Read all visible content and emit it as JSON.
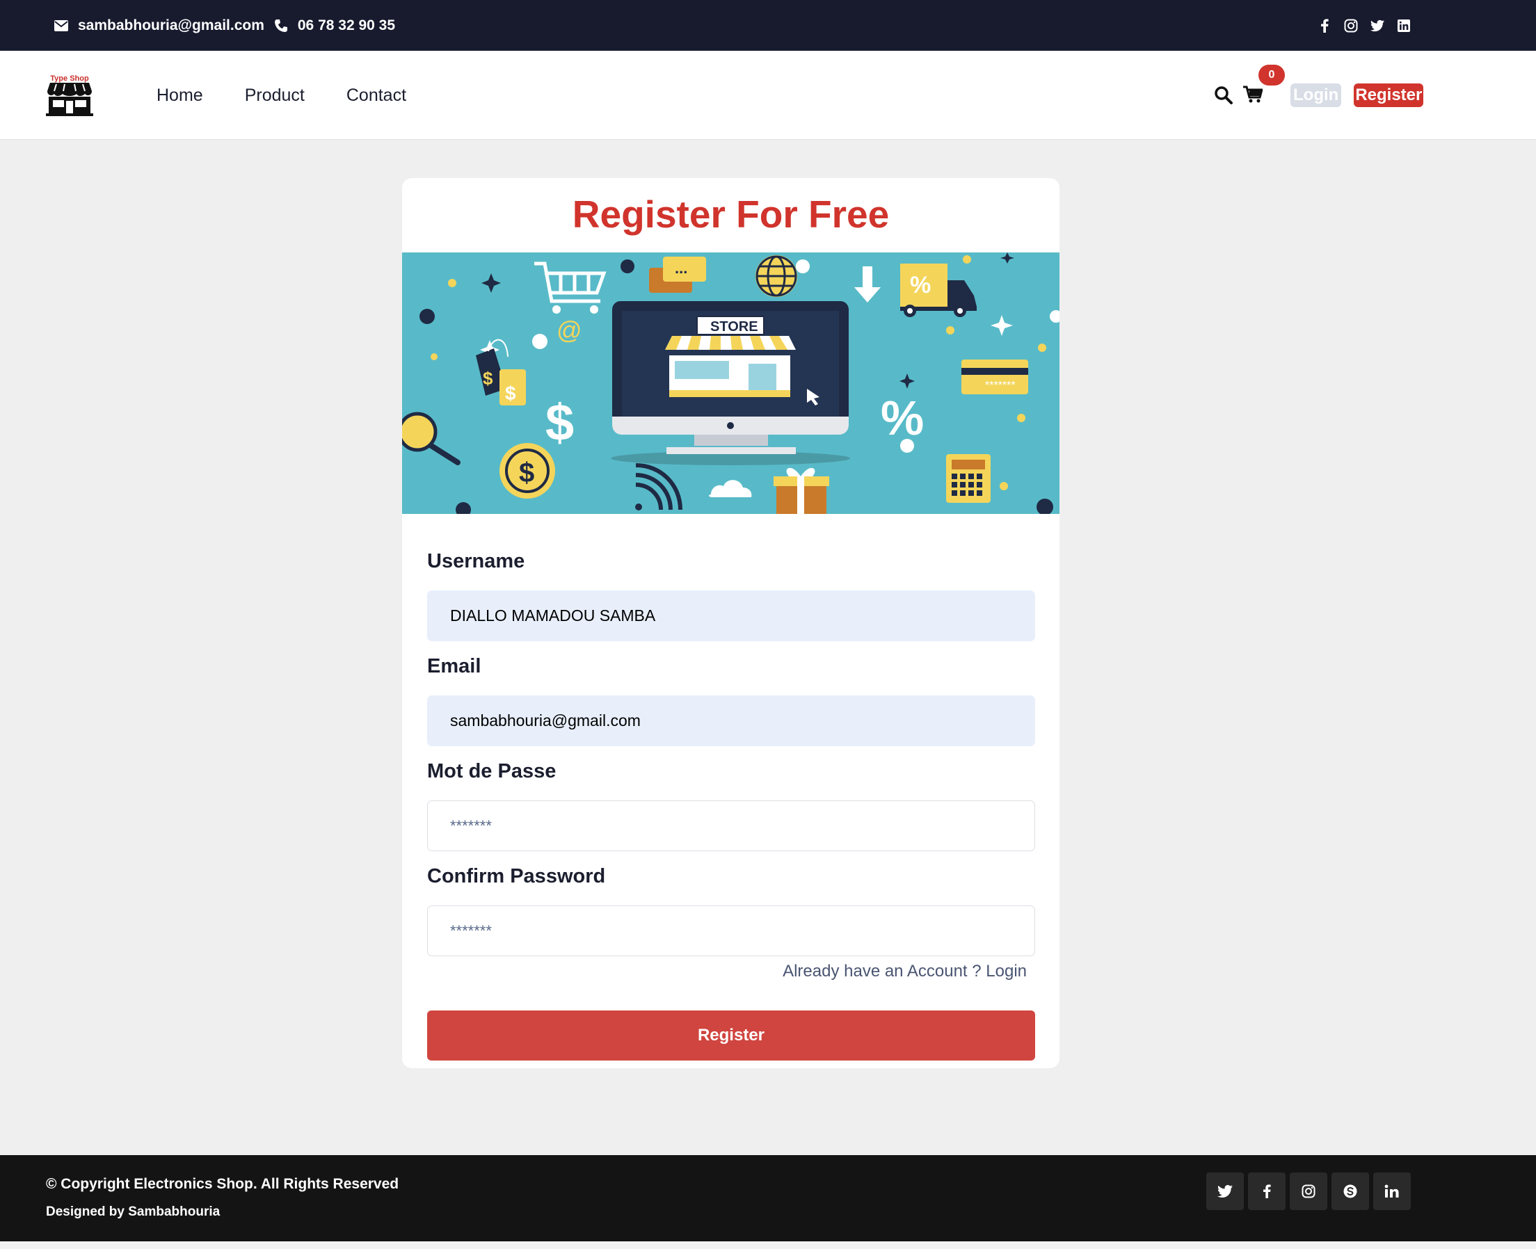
{
  "topbar": {
    "email": "sambabhouria@gmail.com",
    "phone": "06 78 32 90 35",
    "social_icons": [
      "facebook-icon",
      "instagram-icon",
      "twitter-icon",
      "linkedin-icon"
    ]
  },
  "header": {
    "logo_text": "Type Shop",
    "nav": {
      "home": "Home",
      "product": "Product",
      "contact": "Contact"
    },
    "cart_count": "0",
    "login_label": "Login",
    "register_label": "Register"
  },
  "card": {
    "title": "Register For Free",
    "banner_store_sign": "STORE",
    "banner_percent": "%",
    "banner_dollar": "$",
    "banner_at": "@",
    "username": {
      "label": "Username",
      "value": "DIALLO MAMADOU SAMBA"
    },
    "email": {
      "label": "Email",
      "value": "sambabhouria@gmail.com"
    },
    "password": {
      "label": "Mot de Passe",
      "placeholder": "*******"
    },
    "confirm": {
      "label": "Confirm Password",
      "placeholder": "*******"
    },
    "already": "Already have an Account ? Login",
    "submit": "Register"
  },
  "footer": {
    "copyright": "© Copyright Electronics Shop. All Rights Reserved",
    "designed": "Designed by Sambabhouria",
    "social_icons": [
      "twitter-icon",
      "facebook-icon",
      "instagram-icon",
      "skype-icon",
      "linkedin-icon"
    ]
  },
  "colors": {
    "accent": "#d0342c",
    "topbar": "#181b2e",
    "banner": "#58bac8",
    "footer": "#141414"
  }
}
